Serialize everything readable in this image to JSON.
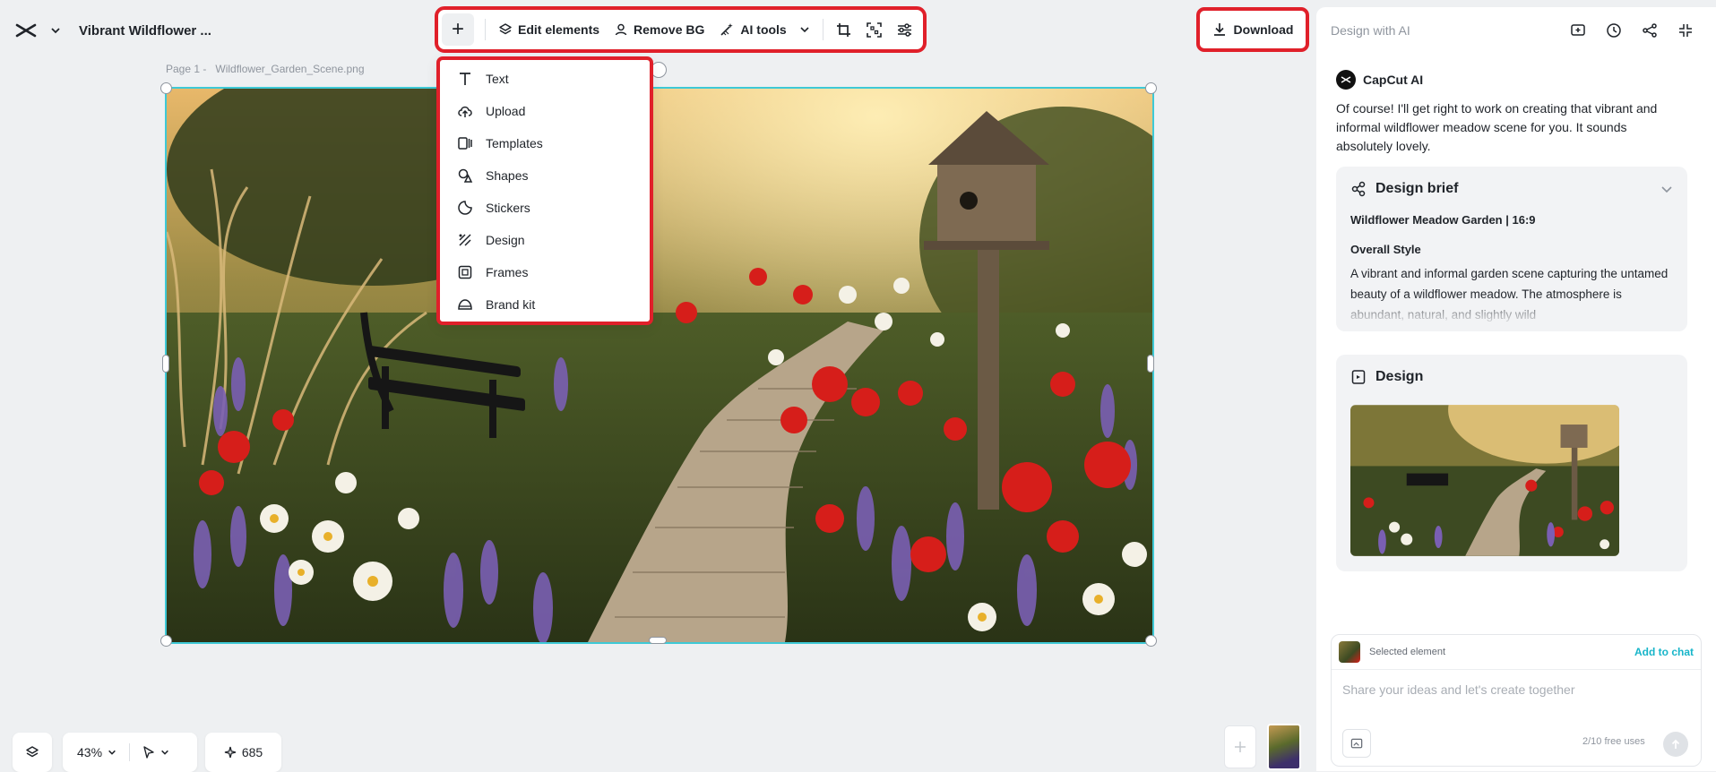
{
  "header": {
    "project_title": "Vibrant Wildflower ...",
    "page_label": "Page 1 -",
    "file_name": "Wildflower_Garden_Scene.png"
  },
  "toolbar": {
    "add_label": "+",
    "edit_elements": "Edit elements",
    "remove_bg": "Remove BG",
    "ai_tools": "AI tools",
    "download": "Download"
  },
  "add_menu": {
    "items": [
      {
        "label": "Text",
        "icon": "text-icon"
      },
      {
        "label": "Upload",
        "icon": "upload-cloud-icon"
      },
      {
        "label": "Templates",
        "icon": "templates-icon"
      },
      {
        "label": "Shapes",
        "icon": "shapes-icon"
      },
      {
        "label": "Stickers",
        "icon": "stickers-icon"
      },
      {
        "label": "Design",
        "icon": "design-icon"
      },
      {
        "label": "Frames",
        "icon": "frames-icon"
      },
      {
        "label": "Brand kit",
        "icon": "brand-kit-icon"
      }
    ]
  },
  "panel": {
    "title": "Design with AI",
    "assistant_name": "CapCut AI",
    "assistant_message": "Of course! I'll get right to work on creating that vibrant and informal wildflower meadow scene for you. It sounds absolutely lovely.",
    "brief": {
      "heading": "Design brief",
      "subtitle": "Wildflower Meadow Garden | 16:9",
      "style_heading": "Overall Style",
      "style_text": "A vibrant and informal garden scene capturing the untamed beauty of a wildflower meadow. The atmosphere is abundant, natural, and slightly wild"
    },
    "design_heading": "Design",
    "selected_element": "Selected element",
    "add_to_chat": "Add to chat",
    "input_placeholder": "Share your ideas and let's create together",
    "free_uses": "2/10 free uses"
  },
  "bottom": {
    "zoom": "43%",
    "credits": "685"
  },
  "colors": {
    "highlight": "#e0202a",
    "selection": "#3ec9d6",
    "accent_link": "#17b5c9"
  }
}
